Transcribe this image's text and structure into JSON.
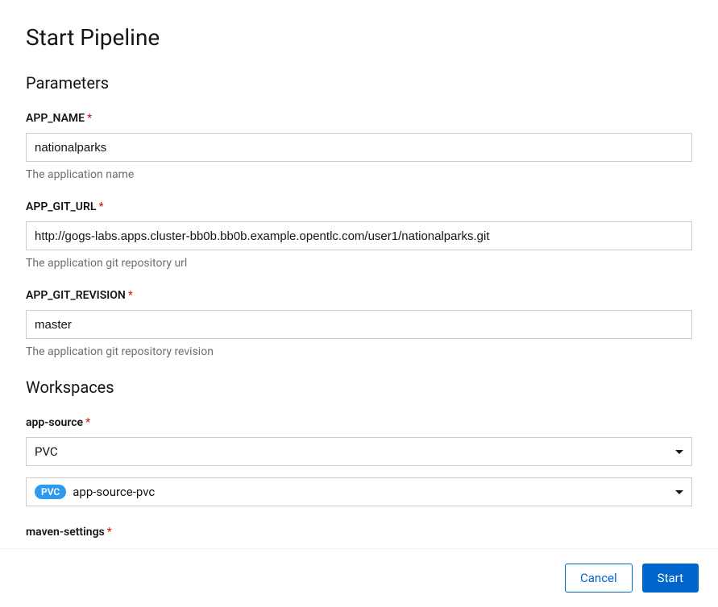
{
  "title": "Start Pipeline",
  "sections": {
    "parameters": {
      "heading": "Parameters",
      "fields": {
        "app_name": {
          "label": "APP_NAME",
          "value": "nationalparks",
          "help": "The application name"
        },
        "app_git_url": {
          "label": "APP_GIT_URL",
          "value": "http://gogs-labs.apps.cluster-bb0b.bb0b.example.opentlc.com/user1/nationalparks.git",
          "help": "The application git repository url"
        },
        "app_git_revision": {
          "label": "APP_GIT_REVISION",
          "value": "master",
          "help": "The application git repository revision"
        }
      }
    },
    "workspaces": {
      "heading": "Workspaces",
      "fields": {
        "app_source": {
          "label": "app-source",
          "type_value": "PVC",
          "pvc_badge": "PVC",
          "pvc_value": "app-source-pvc"
        },
        "maven_settings": {
          "label": "maven-settings"
        }
      }
    }
  },
  "footer": {
    "cancel": "Cancel",
    "start": "Start"
  },
  "required_marker": "*"
}
